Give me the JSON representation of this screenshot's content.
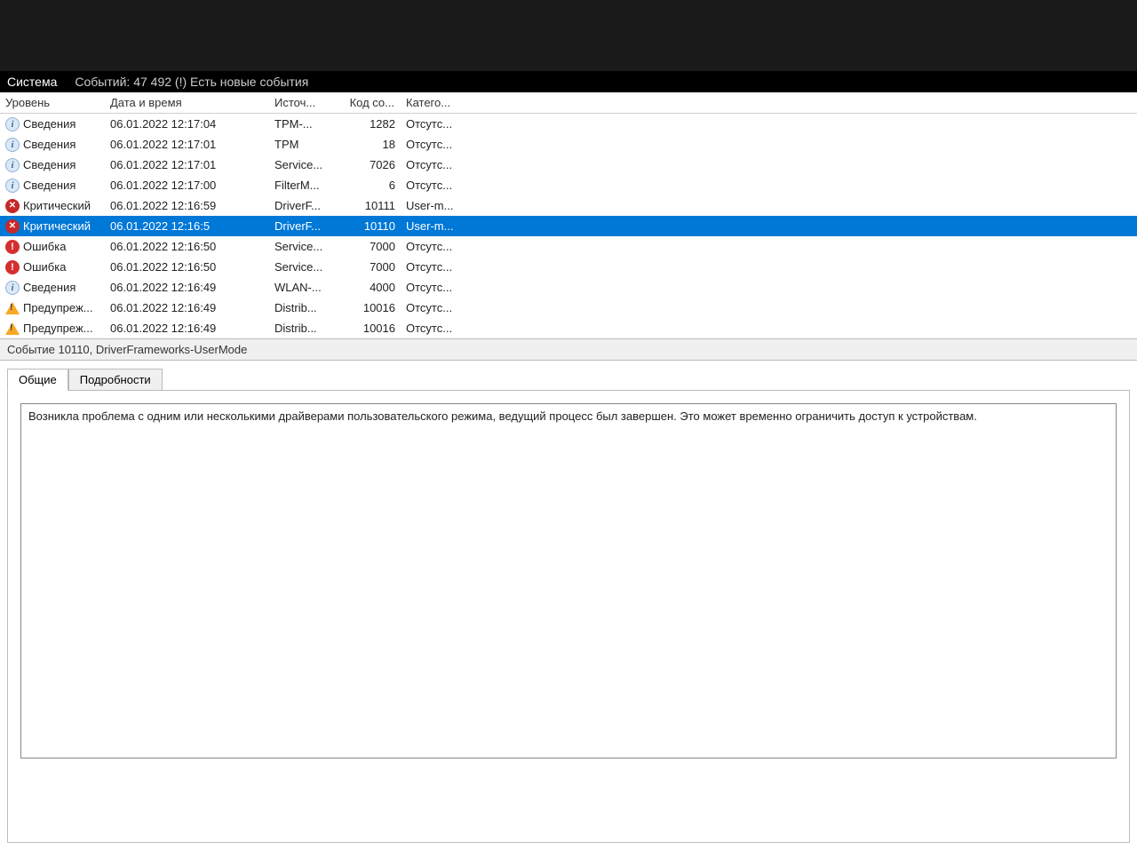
{
  "titlebar": {
    "system": "Система",
    "events_label": "Событий: 47 492 (!) Есть новые события"
  },
  "columns": {
    "level": "Уровень",
    "date": "Дата и время",
    "source": "Источ...",
    "code": "Код со...",
    "category": "Катего..."
  },
  "levels": {
    "info": "Сведения",
    "critical": "Критический",
    "error": "Ошибка",
    "warning": "Предупреж..."
  },
  "rows": [
    {
      "lvl": "info",
      "date": "06.01.2022 12:17:04",
      "src": "TPM-...",
      "code": "1282",
      "cat": "Отсутс...",
      "sel": false
    },
    {
      "lvl": "info",
      "date": "06.01.2022 12:17:01",
      "src": "TPM",
      "code": "18",
      "cat": "Отсутс...",
      "sel": false
    },
    {
      "lvl": "info",
      "date": "06.01.2022 12:17:01",
      "src": "Service...",
      "code": "7026",
      "cat": "Отсутс...",
      "sel": false
    },
    {
      "lvl": "info",
      "date": "06.01.2022 12:17:00",
      "src": "FilterM...",
      "code": "6",
      "cat": "Отсутс...",
      "sel": false
    },
    {
      "lvl": "critical",
      "date": "06.01.2022 12:16:59",
      "src": "DriverF...",
      "code": "10111",
      "cat": "User-m...",
      "sel": false
    },
    {
      "lvl": "critical",
      "date": "06.01.2022 12:16:5",
      "src": "DriverF...",
      "code": "10110",
      "cat": "User-m...",
      "sel": true
    },
    {
      "lvl": "error",
      "date": "06.01.2022 12:16:50",
      "src": "Service...",
      "code": "7000",
      "cat": "Отсутс...",
      "sel": false
    },
    {
      "lvl": "error",
      "date": "06.01.2022 12:16:50",
      "src": "Service...",
      "code": "7000",
      "cat": "Отсутс...",
      "sel": false
    },
    {
      "lvl": "info",
      "date": "06.01.2022 12:16:49",
      "src": "WLAN-...",
      "code": "4000",
      "cat": "Отсутс...",
      "sel": false
    },
    {
      "lvl": "warning",
      "date": "06.01.2022 12:16:49",
      "src": "Distrib...",
      "code": "10016",
      "cat": "Отсутс...",
      "sel": false
    },
    {
      "lvl": "warning",
      "date": "06.01.2022 12:16:49",
      "src": "Distrib...",
      "code": "10016",
      "cat": "Отсутс...",
      "sel": false
    }
  ],
  "detail": {
    "header": "Событие 10110, DriverFrameworks-UserMode",
    "tabs": {
      "general": "Общие",
      "details": "Подробности"
    },
    "message": "Возникла проблема с одним или несколькими драйверами пользовательского режима, ведущий процесс был завершен. Это может временно ограничить доступ к устройствам."
  }
}
